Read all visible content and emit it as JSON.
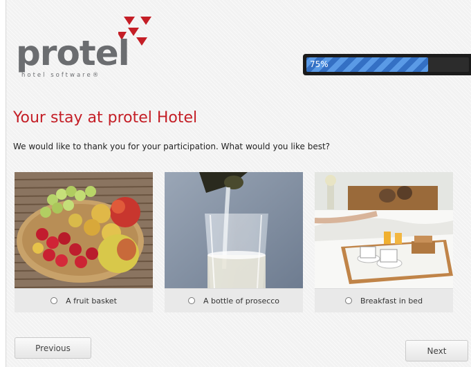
{
  "brand": {
    "name": "protel",
    "tagline": "hotel software®",
    "accent_color": "#c41e26"
  },
  "progress": {
    "label": "75%",
    "value": 0.75
  },
  "page": {
    "title": "Your stay at protel Hotel",
    "question": "We would like to thank you for your participation. What would you like best?"
  },
  "options": [
    {
      "label": "A fruit basket",
      "image": "fruit-basket-photo",
      "selected": false
    },
    {
      "label": "A bottle of prosecco",
      "image": "prosecco-pour-photo",
      "selected": false
    },
    {
      "label": "Breakfast in bed",
      "image": "breakfast-in-bed-photo",
      "selected": false
    }
  ],
  "nav": {
    "previous_label": "Previous",
    "next_label": "Next"
  }
}
